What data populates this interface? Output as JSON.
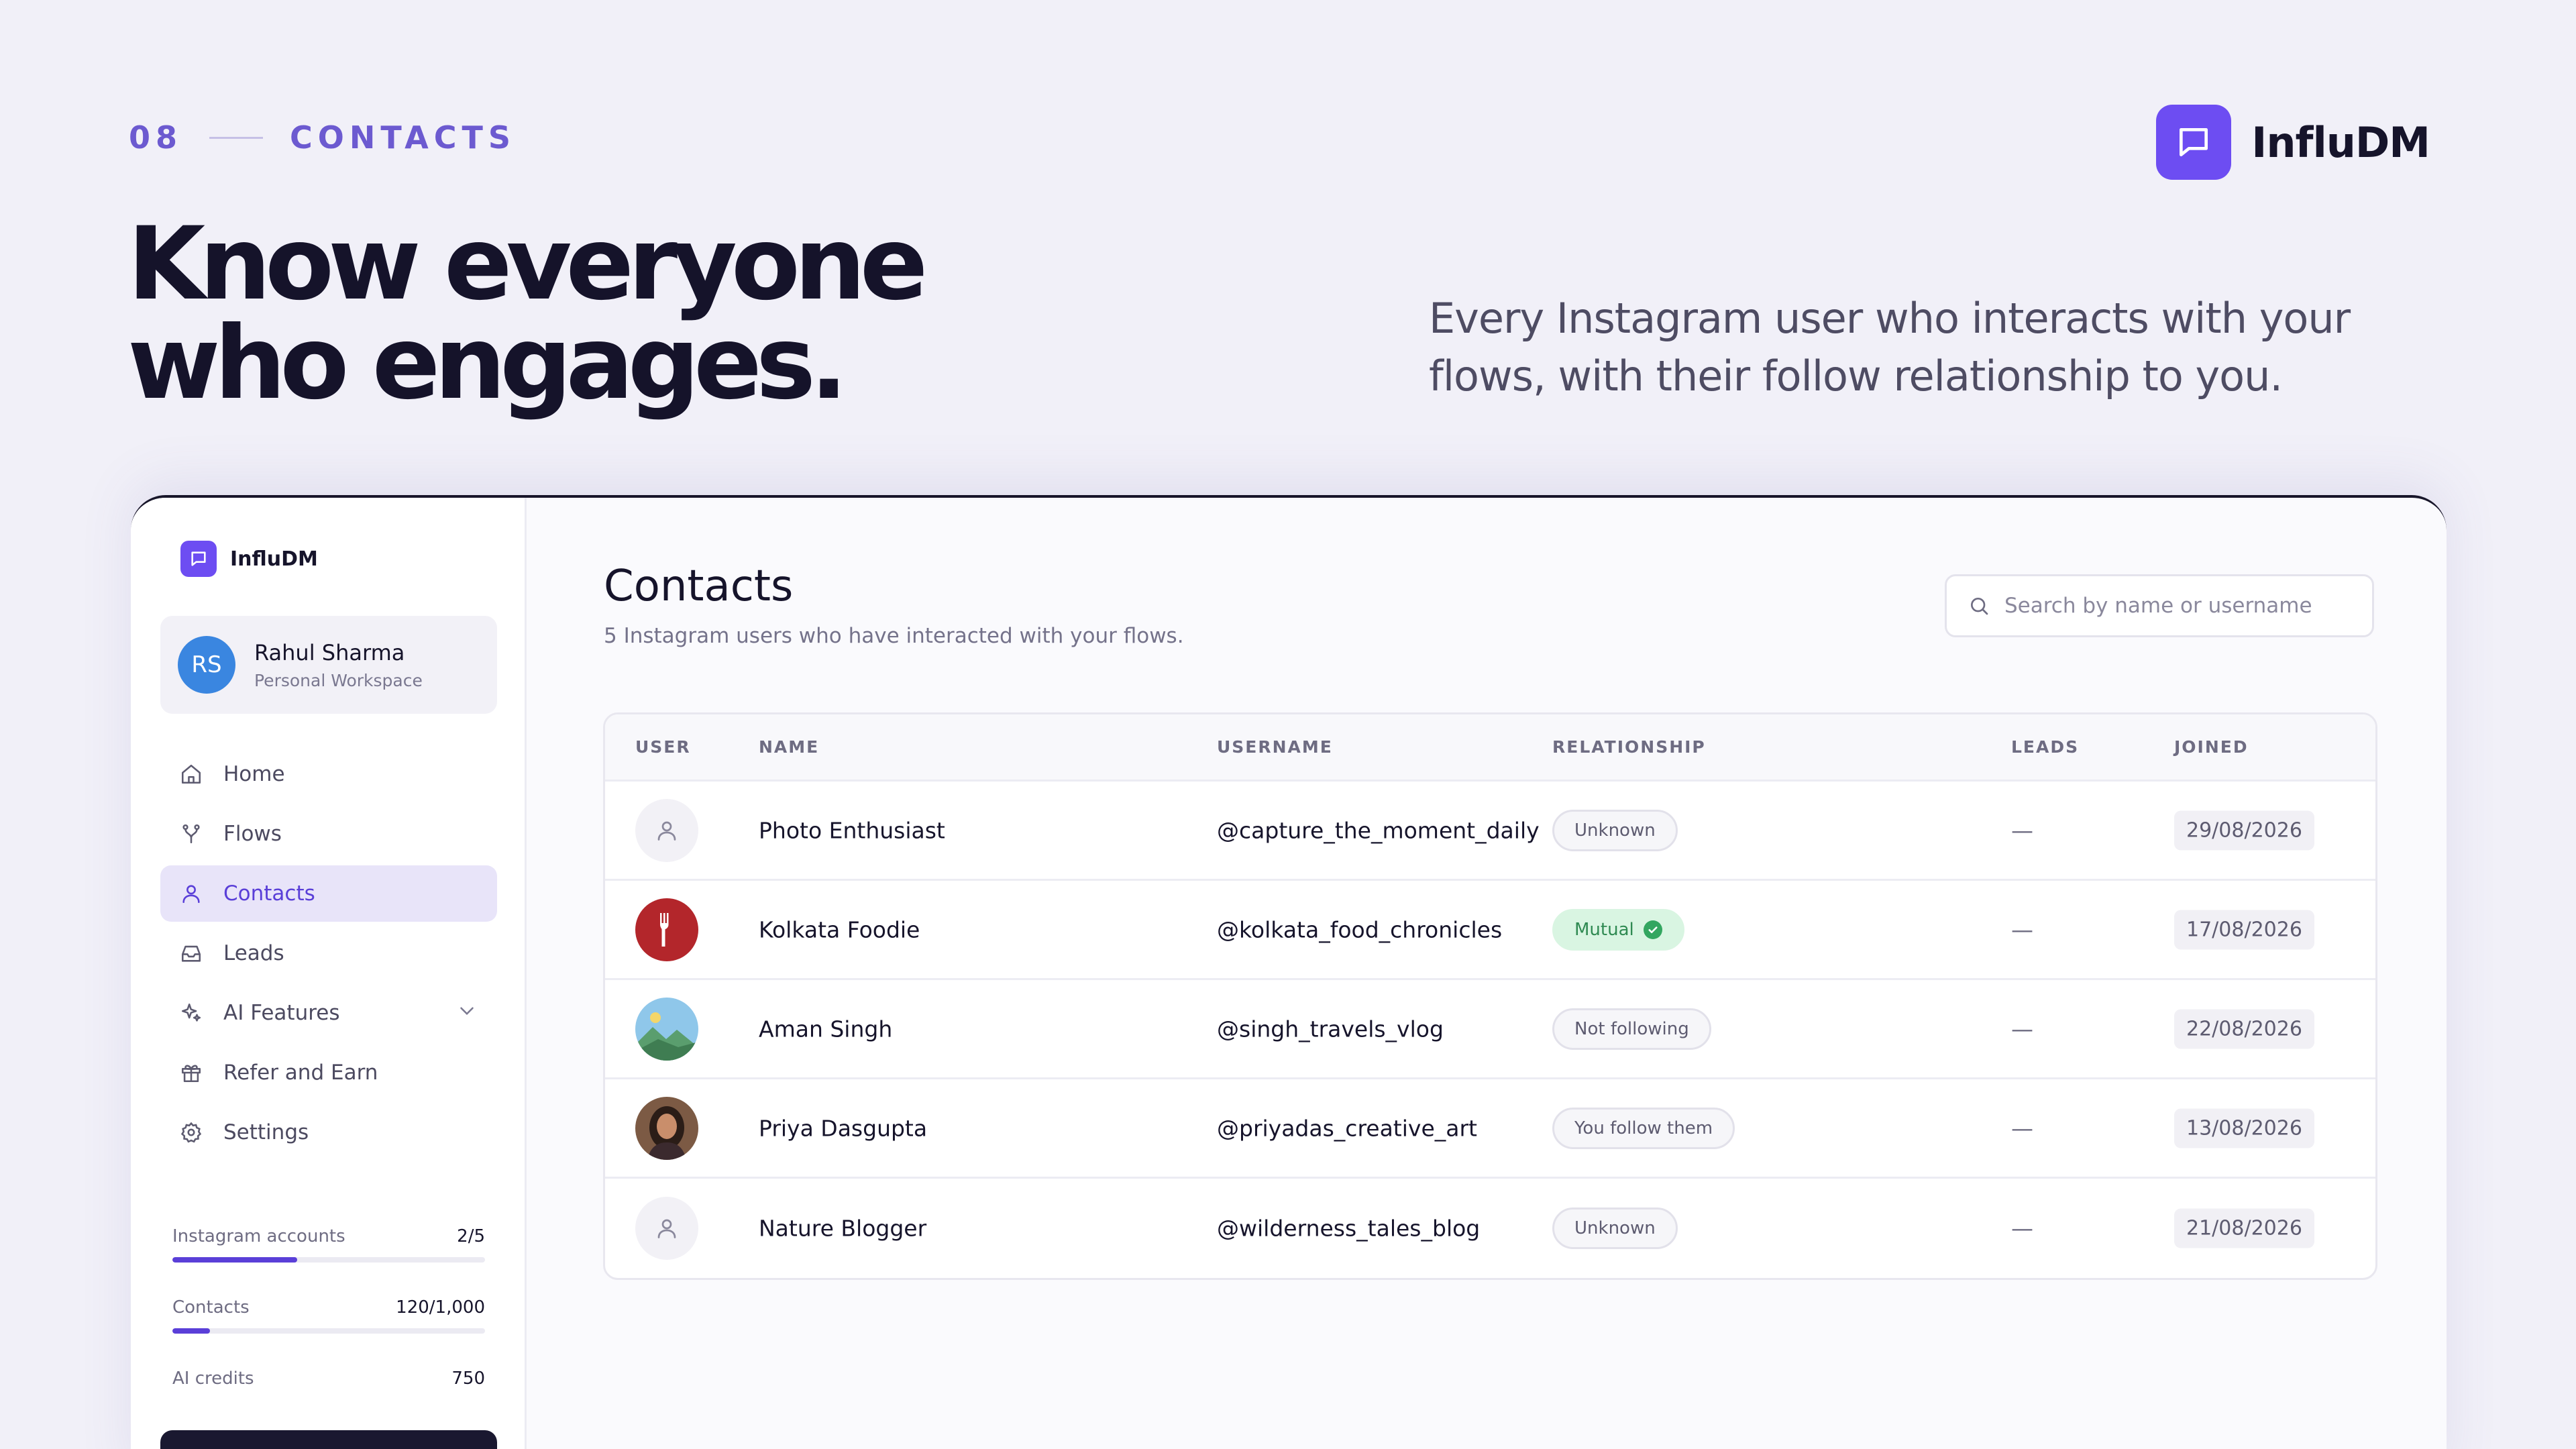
{
  "slide": {
    "number": "08",
    "section": "CONTACTS",
    "headline_line1": "Know everyone",
    "headline_line2": "who engages.",
    "subhead": "Every Instagram user who interacts with your flows, with their follow relationship to you.",
    "brand_name": "InfluDM",
    "accent_color": "#6d4df2"
  },
  "sidebar": {
    "brand_name": "InfluDM",
    "workspace": {
      "initials": "RS",
      "name": "Rahul Sharma",
      "subtitle": "Personal Workspace",
      "avatar_color": "#3a86e0"
    },
    "nav": [
      {
        "label": "Home",
        "icon": "home-icon"
      },
      {
        "label": "Flows",
        "icon": "flow-icon"
      },
      {
        "label": "Contacts",
        "icon": "user-icon",
        "active": true
      },
      {
        "label": "Leads",
        "icon": "inbox-icon"
      },
      {
        "label": "AI Features",
        "icon": "sparkle-icon",
        "has_chevron": true
      },
      {
        "label": "Refer and Earn",
        "icon": "gift-icon"
      },
      {
        "label": "Settings",
        "icon": "gear-icon"
      }
    ],
    "usage": [
      {
        "label": "Instagram accounts",
        "value": "2/5",
        "fraction": 0.4
      },
      {
        "label": "Contacts",
        "value": "120/1,000",
        "fraction": 0.12
      },
      {
        "label": "AI credits",
        "value": "750"
      }
    ]
  },
  "main": {
    "title": "Contacts",
    "subtitle": "5 Instagram users who have interacted with your flows.",
    "search_placeholder": "Search by name or username",
    "columns": {
      "user": "USER",
      "name": "NAME",
      "username": "USERNAME",
      "relationship": "RELATIONSHIP",
      "leads": "LEADS",
      "joined": "JOINED"
    },
    "rows": [
      {
        "avatar": "placeholder",
        "name": "Photo Enthusiast",
        "username": "@capture_the_moment_daily",
        "relationship": "Unknown",
        "leads": "—",
        "joined": "29/08/2026"
      },
      {
        "avatar": "food",
        "name": "Kolkata Foodie",
        "username": "@kolkata_food_chronicles",
        "relationship": "Mutual",
        "leads": "—",
        "joined": "17/08/2026"
      },
      {
        "avatar": "landscape",
        "name": "Aman Singh",
        "username": "@singh_travels_vlog",
        "relationship": "Not following",
        "leads": "—",
        "joined": "22/08/2026"
      },
      {
        "avatar": "portrait",
        "name": "Priya Dasgupta",
        "username": "@priyadas_creative_art",
        "relationship": "You follow them",
        "leads": "—",
        "joined": "13/08/2026"
      },
      {
        "avatar": "placeholder",
        "name": "Nature Blogger",
        "username": "@wilderness_tales_blog",
        "relationship": "Unknown",
        "leads": "—",
        "joined": "21/08/2026"
      }
    ]
  }
}
